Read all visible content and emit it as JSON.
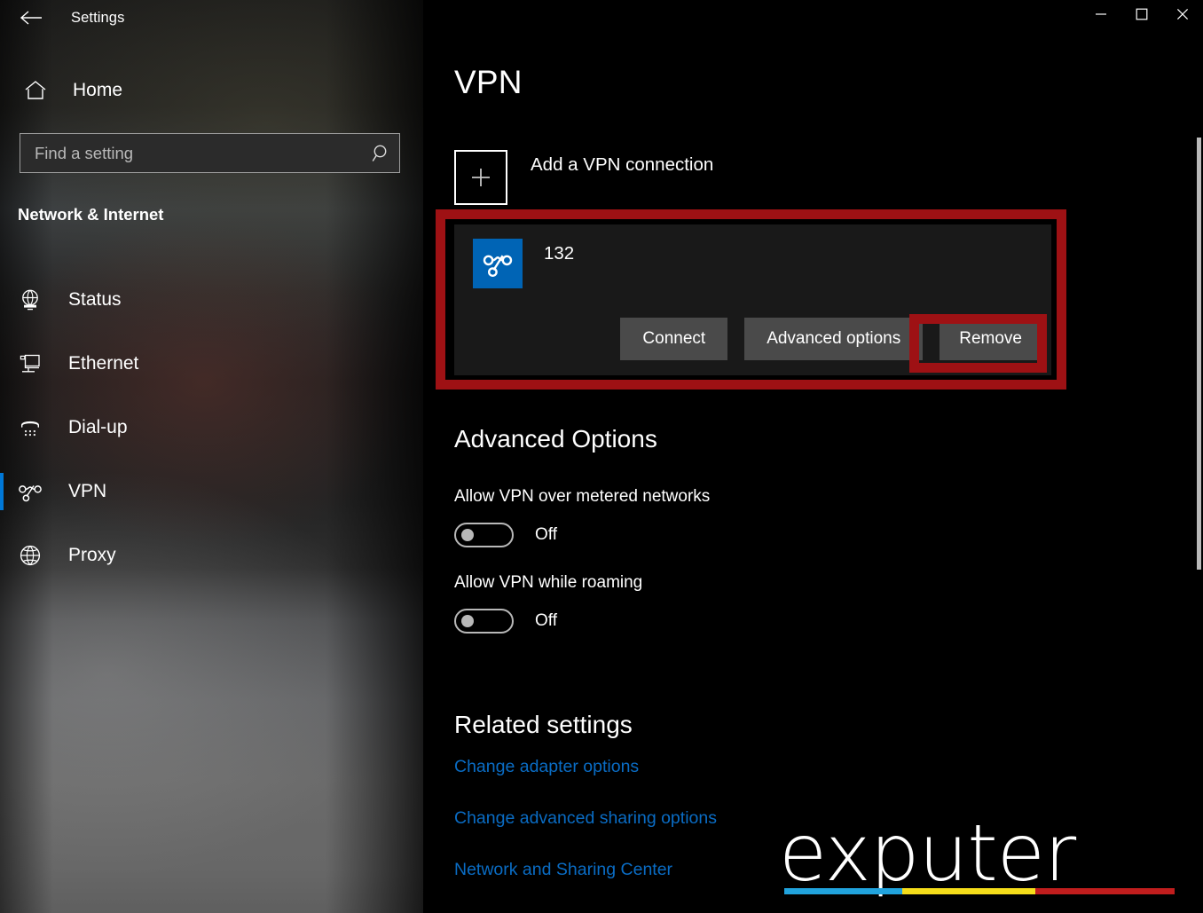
{
  "window": {
    "app_title": "Settings",
    "back_icon": "back-arrow-icon",
    "minimize_label": "—",
    "maximize_label": "☐",
    "close_label": "✕"
  },
  "sidebar": {
    "home_label": "Home",
    "home_icon": "home-icon",
    "search": {
      "placeholder": "Find a setting",
      "value": "",
      "icon": "search-icon"
    },
    "category": "Network & Internet",
    "items": [
      {
        "label": "Status",
        "icon": "globe-monitor-icon",
        "selected": false
      },
      {
        "label": "Ethernet",
        "icon": "monitor-plug-icon",
        "selected": false
      },
      {
        "label": "Dial-up",
        "icon": "phone-handset-icon",
        "selected": false
      },
      {
        "label": "VPN",
        "icon": "vpn-key-icon",
        "selected": true
      },
      {
        "label": "Proxy",
        "icon": "globe-icon",
        "selected": false
      }
    ]
  },
  "main": {
    "page_title": "VPN",
    "add_connection": {
      "label": "Add a VPN connection",
      "icon": "plus-icon"
    },
    "connection": {
      "name": "132",
      "icon": "vpn-connection-tile-icon",
      "buttons": [
        {
          "label": "Connect",
          "name": "connect-button",
          "highlighted": false
        },
        {
          "label": "Advanced options",
          "name": "advanced-options-button",
          "highlighted": false
        },
        {
          "label": "Remove",
          "name": "remove-button",
          "highlighted": true
        }
      ]
    },
    "advanced_options": {
      "heading": "Advanced Options",
      "settings": [
        {
          "label": "Allow VPN over metered networks",
          "state": "Off",
          "checked": false
        },
        {
          "label": "Allow VPN while roaming",
          "state": "Off",
          "checked": false
        }
      ]
    },
    "related_settings": {
      "heading": "Related settings",
      "links": [
        "Change adapter options",
        "Change advanced sharing options",
        "Network and Sharing Center"
      ]
    }
  },
  "watermark": {
    "text": "exputer",
    "bar_colors": [
      "#21a3dd",
      "#f5dd1a",
      "#c01d1d"
    ]
  },
  "colors": {
    "page_background": "#000000",
    "card_background": "#191919",
    "button_face": "#4a4a4a",
    "annotation_red": "#9e1114",
    "link_blue": "#0a6cc4",
    "accent_blue": "#0078d7",
    "vpn_tile_blue": "#0064b5",
    "text_primary": "#ffffff"
  }
}
